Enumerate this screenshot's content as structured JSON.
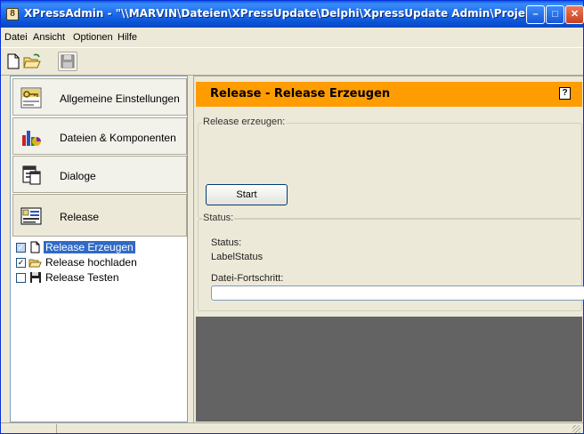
{
  "window": {
    "title": "XPressAdmin - \"\\\\MARVIN\\Dateien\\XPressUpdate\\Delphi\\XpressUpdate Admin\\Projekte\\Blö...",
    "app_icon": "app-icon",
    "min_symbol": "–",
    "max_symbol": "□",
    "close_symbol": "✕"
  },
  "menu": {
    "items": [
      {
        "label": "Datei"
      },
      {
        "label": "Ansicht"
      },
      {
        "label": "Optionen"
      },
      {
        "label": "Hilfe"
      }
    ]
  },
  "toolbar": {
    "new_icon": "new-file-icon",
    "open_icon": "open-folder-icon",
    "save_icon": "save-disk-icon"
  },
  "nav": {
    "items": [
      {
        "label": "Allgemeine Einstellungen",
        "icon": "key-icon"
      },
      {
        "label": "Dateien & Komponenten",
        "icon": "chart-icon"
      },
      {
        "label": "Dialoge",
        "icon": "dialog-icon"
      },
      {
        "label": "Release",
        "icon": "release-icon"
      }
    ]
  },
  "tree": {
    "items": [
      {
        "label": "Release Erzeugen",
        "checked": true,
        "selected": true
      },
      {
        "label": "Release hochladen",
        "checked": true,
        "selected": false
      },
      {
        "label": "Release Testen",
        "checked": false,
        "selected": false
      }
    ]
  },
  "content": {
    "header_title": "Release - Release Erzeugen",
    "help_symbol": "?",
    "group_create": {
      "title": "Release erzeugen:",
      "start_label": "Start"
    },
    "group_status": {
      "title": "Status:",
      "status_label": "Status:",
      "status_value": "LabelStatus",
      "progress_label": "Datei-Fortschritt:",
      "progress": 0
    }
  },
  "colors": {
    "header_bg": "#ff9c00",
    "titlebar": "#0b53d4",
    "selection": "#316ac5",
    "dark_area": "#636363"
  }
}
